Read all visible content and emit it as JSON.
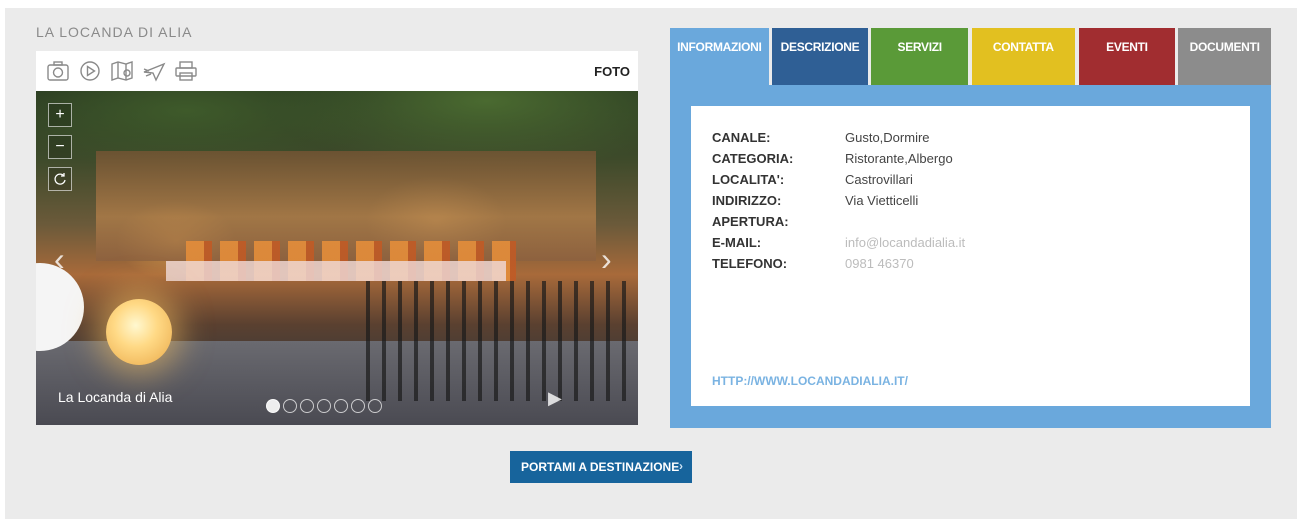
{
  "title": "LA LOCANDA DI ALIA",
  "toolbar": {
    "foto_label": "FOTO",
    "icons": [
      "camera-icon",
      "play-icon",
      "map-icon",
      "plane-icon",
      "printer-icon"
    ]
  },
  "gallery": {
    "caption": "La Locanda di Alia",
    "zoom_in": "+",
    "zoom_out": "−",
    "arrow_prev": "‹",
    "arrow_next": "›",
    "play": "▶",
    "dot_count": 7,
    "active_dot": 0
  },
  "tabs": [
    {
      "label": "INFORMAZIONI",
      "color": "#6aa8dc"
    },
    {
      "label": "DESCRIZIONE",
      "color": "#2f5f95"
    },
    {
      "label": "SERVIZI",
      "color": "#5a9a38"
    },
    {
      "label": "CONTATTA",
      "color": "#e2c020"
    },
    {
      "label": "EVENTI",
      "color": "#a12d30"
    },
    {
      "label": "DOCUMENTI",
      "color": "#8c8c8c"
    }
  ],
  "info": {
    "rows": [
      {
        "label": "CANALE:",
        "value": "Gusto,Dormire"
      },
      {
        "label": "CATEGORIA:",
        "value": "Ristorante,Albergo"
      },
      {
        "label": "LOCALITA':",
        "value": "Castrovillari"
      },
      {
        "label": "INDIRIZZO:",
        "value": "Via Vietticelli"
      },
      {
        "label": "APERTURA:",
        "value": ""
      },
      {
        "label": "E-MAIL:",
        "value": "info@locandadialia.it"
      },
      {
        "label": "TELEFONO:",
        "value": "0981 46370"
      }
    ],
    "website": "HTTP://WWW.LOCANDADIALIA.IT/"
  },
  "destination_button": "PORTAMI A DESTINAZIONE",
  "destination_chevron": "›"
}
